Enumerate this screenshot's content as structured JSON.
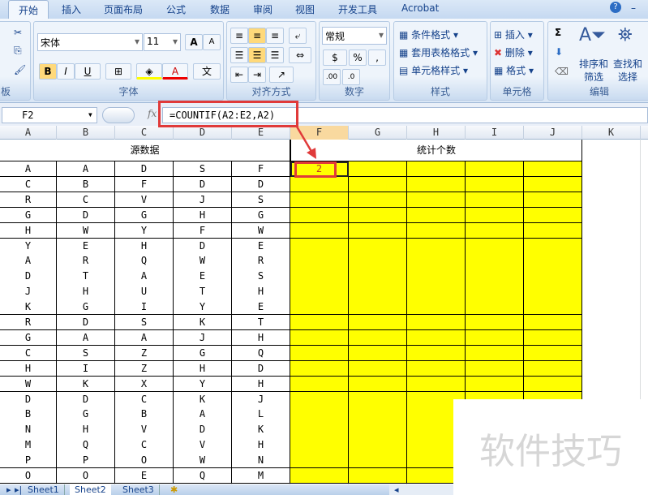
{
  "tabs": [
    "开始",
    "插入",
    "页面布局",
    "公式",
    "数据",
    "审阅",
    "视图",
    "开发工具",
    "Acrobat"
  ],
  "ribbon": {
    "clipboard_label": "板",
    "font": {
      "label": "字体",
      "name": "宋体",
      "size": "11",
      "grow": "A",
      "shrink": "A",
      "bold": "B",
      "italic": "I",
      "underline": "U",
      "border": "⊞",
      "fill": "◈",
      "color": "A",
      "phonetic": "文"
    },
    "align": {
      "label": "对齐方式"
    },
    "number": {
      "label": "数字",
      "format": "常规",
      "percent": "%",
      "comma": ",",
      "inc": ".00",
      "dec": ".0"
    },
    "styles": {
      "label": "样式",
      "items": [
        "条件格式",
        "套用表格格式",
        "单元格样式"
      ]
    },
    "cells": {
      "label": "单元格",
      "items": [
        "插入",
        "删除",
        "格式"
      ]
    },
    "editing": {
      "label": "编辑",
      "sum": "Σ",
      "sort1": "排序和",
      "sort2": "筛选",
      "find1": "查找和",
      "find2": "选择"
    }
  },
  "formula_bar": {
    "name_box": "F2",
    "fx": "fx",
    "formula": "=COUNTIF(A2:E2,A2)"
  },
  "columns": [
    "A",
    "B",
    "C",
    "D",
    "E",
    "F",
    "G",
    "H",
    "I",
    "J",
    "K"
  ],
  "headers": {
    "source": "源数据",
    "count": "统计个数"
  },
  "rows": [
    [
      "A",
      "A",
      "D",
      "S",
      "F"
    ],
    [
      "C",
      "B",
      "F",
      "D",
      "D"
    ],
    [
      "R",
      "C",
      "V",
      "J",
      "S"
    ],
    [
      "G",
      "D",
      "G",
      "H",
      "G"
    ],
    [
      "H",
      "W",
      "Y",
      "F",
      "W"
    ],
    [
      "Y",
      "E",
      "H",
      "D",
      "E"
    ],
    [
      "A",
      "R",
      "Q",
      "W",
      "R"
    ],
    [
      "D",
      "T",
      "A",
      "E",
      "S"
    ],
    [
      "J",
      "H",
      "U",
      "T",
      "H"
    ],
    [
      "K",
      "G",
      "I",
      "Y",
      "E"
    ],
    [
      "R",
      "D",
      "S",
      "K",
      "T"
    ],
    [
      "G",
      "A",
      "A",
      "J",
      "H"
    ],
    [
      "C",
      "S",
      "Z",
      "G",
      "Q"
    ],
    [
      "H",
      "I",
      "Z",
      "H",
      "D"
    ],
    [
      "W",
      "K",
      "X",
      "Y",
      "H"
    ],
    [
      "D",
      "D",
      "C",
      "K",
      "J"
    ],
    [
      "B",
      "G",
      "B",
      "A",
      "L"
    ],
    [
      "N",
      "H",
      "V",
      "D",
      "K"
    ],
    [
      "M",
      "Q",
      "C",
      "V",
      "H"
    ],
    [
      "P",
      "P",
      "O",
      "W",
      "N"
    ],
    [
      "O",
      "O",
      "E",
      "Q",
      "M"
    ]
  ],
  "result_F2": "2",
  "sheets": [
    "Sheet1",
    "Sheet2",
    "Sheet3"
  ],
  "active_sheet": "Sheet2",
  "watermark": "软件技巧",
  "colors": {
    "highlight": "#ffff00",
    "annotation": "#e03a3a"
  }
}
